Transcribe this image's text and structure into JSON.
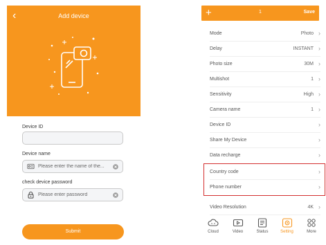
{
  "left_screen": {
    "title": "Add device",
    "back_icon": "chevron-left-icon",
    "device_id_label": "Device ID",
    "device_id_value": "",
    "device_name_label": "Device name",
    "device_name_placeholder": "Please enter the name of the...",
    "password_label": "check device password",
    "password_placeholder": "Please enter password",
    "submit_label": "Submit"
  },
  "right_screen": {
    "topbar": {
      "add_icon": "plus-icon",
      "count": "1",
      "save_label": "Save"
    },
    "settings": [
      {
        "key": "Mode",
        "value": "Photo"
      },
      {
        "key": "Delay",
        "value": "INSTANT"
      },
      {
        "key": "Photo size",
        "value": "30M"
      },
      {
        "key": "Multishot",
        "value": "1"
      },
      {
        "key": "Sensitivity",
        "value": "High"
      },
      {
        "key": "Camera name",
        "value": "1"
      },
      {
        "key": "Device ID",
        "value": ""
      },
      {
        "key": "Share My Device",
        "value": ""
      },
      {
        "key": "Data recharge",
        "value": ""
      },
      {
        "key": "Country code",
        "value": ""
      },
      {
        "key": "Phone number",
        "value": ""
      },
      {
        "key": "Video Resolution",
        "value": "4K"
      }
    ],
    "tabs": [
      {
        "label": "Cloud",
        "icon": "cloud-icon"
      },
      {
        "label": "Video",
        "icon": "video-icon"
      },
      {
        "label": "Status",
        "icon": "status-icon"
      },
      {
        "label": "Setting",
        "icon": "gear-icon",
        "active": true
      },
      {
        "label": "More",
        "icon": "grid-icon"
      }
    ]
  },
  "colors": {
    "accent": "#f7961e",
    "highlight": "#d32f2f"
  }
}
